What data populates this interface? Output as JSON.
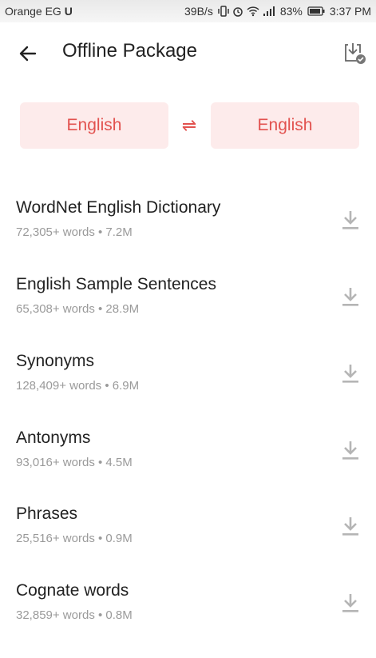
{
  "status_bar": {
    "carrier": "Orange EG",
    "carrier_badge": "U",
    "speed": "39B/s",
    "battery": "83%",
    "time": "3:37 PM"
  },
  "appbar": {
    "title": "Offline Package",
    "back_icon": "arrow-left-icon",
    "download_manager_icon": "download-check-icon"
  },
  "languages": {
    "source": "English",
    "swap_symbol": "⇌",
    "target": "English"
  },
  "packages": [
    {
      "name": "WordNet English Dictionary",
      "words": "72,305+ words",
      "size": "7.2M"
    },
    {
      "name": "English Sample Sentences",
      "words": "65,308+ words",
      "size": "28.9M"
    },
    {
      "name": "Synonyms",
      "words": "128,409+ words",
      "size": "6.9M"
    },
    {
      "name": "Antonyms",
      "words": "93,016+ words",
      "size": "4.5M"
    },
    {
      "name": "Phrases",
      "words": "25,516+ words",
      "size": "0.9M"
    },
    {
      "name": "Cognate words",
      "words": "32,859+ words",
      "size": "0.8M"
    }
  ],
  "separator": " • ",
  "colors": {
    "accent": "#e2524f",
    "chip_bg": "#fdebeb",
    "meta_text": "#9a9a9a",
    "icon_gray": "#b5b5b5"
  }
}
